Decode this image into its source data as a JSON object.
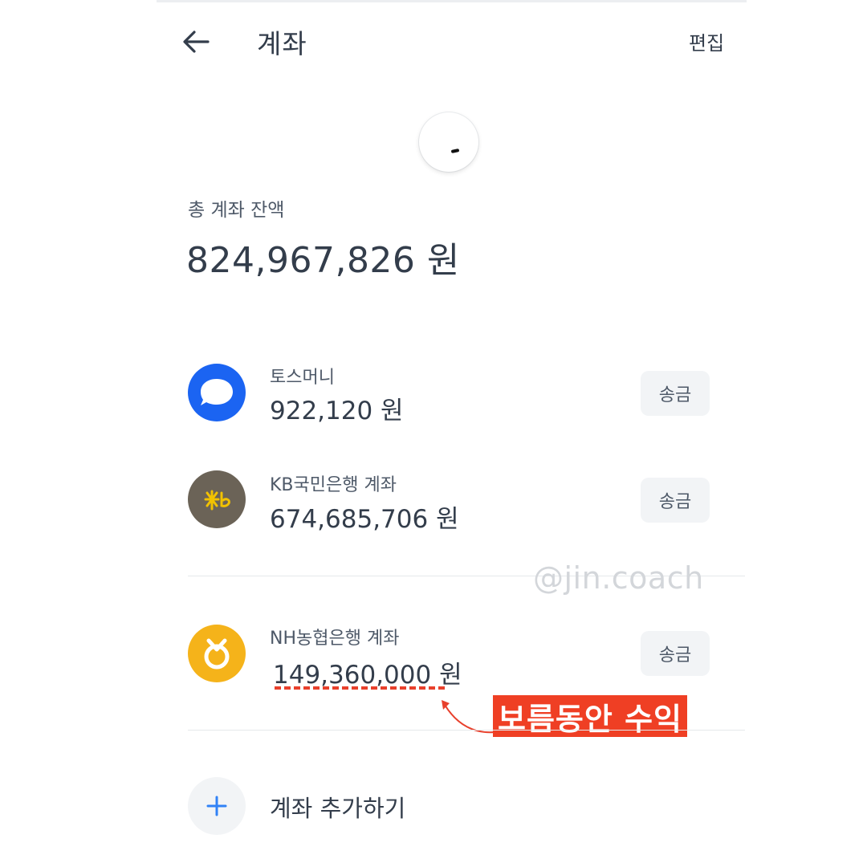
{
  "header": {
    "title": "계좌",
    "edit_label": "편집",
    "back_icon": "arrow-left-icon"
  },
  "summary": {
    "total_label": "총 계좌 잔액",
    "total_amount": "824,967,826 원"
  },
  "accounts": [
    {
      "name": "토스머니",
      "amount": "922,120 원",
      "send_label": "송금",
      "icon": "toss-logo-icon",
      "color": "#1b64f2"
    },
    {
      "name": "KB국민은행 계좌",
      "amount": "674,685,706 원",
      "send_label": "송금",
      "icon": "kb-bank-logo-icon",
      "color": "#6b6357"
    },
    {
      "name": "NH농협은행 계좌",
      "amount": "149,360,000 원",
      "send_label": "송금",
      "icon": "nh-bank-logo-icon",
      "color": "#f5b31a"
    }
  ],
  "add_account": {
    "label": "계좌 추가하기",
    "icon": "plus-icon"
  },
  "overlay": {
    "watermark": "@jin.coach",
    "callout": "보름동안 수익",
    "callout_color": "#ef3f24"
  }
}
